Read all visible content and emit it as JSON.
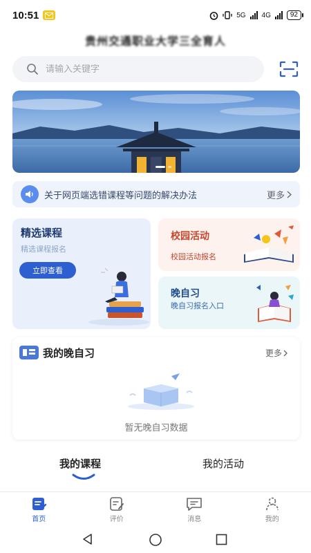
{
  "status_bar": {
    "time": "10:51",
    "signal_1": "5G",
    "signal_2": "4G",
    "battery": "92"
  },
  "app": {
    "title": "贵州交通职业大学三全育人"
  },
  "search": {
    "placeholder": "请输入关键字"
  },
  "notice": {
    "text": "关于网页端选错课程等问题的解决办法",
    "more": "更多"
  },
  "cards": {
    "course": {
      "title": "精选课程",
      "subtitle": "精选课程报名",
      "button": "立即查看"
    },
    "activity": {
      "title": "校园活动",
      "subtitle": "校园活动报名"
    },
    "study": {
      "title": "晚自习",
      "subtitle": "晚自习报名入口"
    }
  },
  "evening_study": {
    "title": "我的晚自习",
    "more": "更多",
    "empty_text": "暂无晚自习数据"
  },
  "tabs": {
    "course": "我的课程",
    "activity": "我的活动"
  },
  "bottom_nav": {
    "items": [
      {
        "label": "首页",
        "icon": "home-icon",
        "active": true
      },
      {
        "label": "评价",
        "icon": "evaluate-icon"
      },
      {
        "label": "消息",
        "icon": "message-icon"
      },
      {
        "label": "我的",
        "icon": "profile-icon"
      }
    ]
  },
  "colors": {
    "primary": "#2d5fd1",
    "accent_red": "#c6452c"
  }
}
